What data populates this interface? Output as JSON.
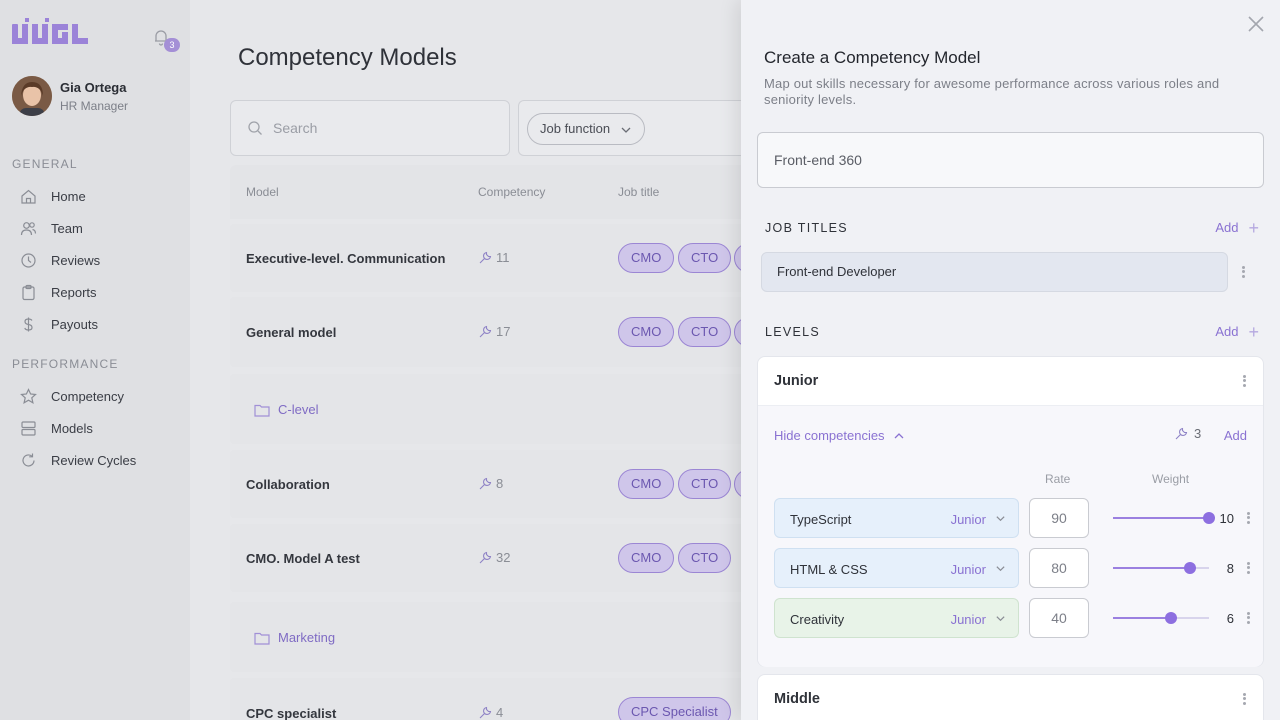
{
  "app": {
    "logo_text": "JUGL",
    "notification_count": "3"
  },
  "user": {
    "name": "Gia Ortega",
    "role": "HR Manager"
  },
  "nav": {
    "general_label": "GENERAL",
    "general_items": [
      {
        "label": "Home",
        "icon": "home-icon"
      },
      {
        "label": "Team",
        "icon": "team-icon"
      },
      {
        "label": "Reviews",
        "icon": "clock-icon"
      },
      {
        "label": "Reports",
        "icon": "clipboard-icon"
      },
      {
        "label": "Payouts",
        "icon": "dollar-icon"
      }
    ],
    "performance_label": "PERFORMANCE",
    "performance_items": [
      {
        "label": "Competency",
        "icon": "star-icon"
      },
      {
        "label": "Models",
        "icon": "models-icon"
      },
      {
        "label": "Review Cycles",
        "icon": "refresh-icon"
      }
    ]
  },
  "main": {
    "title": "Competency Models",
    "search_placeholder": "Search",
    "filter_label": "Job function",
    "columns": [
      "Model",
      "Competency",
      "Job title"
    ],
    "rows": [
      {
        "name": "Executive-level. Communication",
        "count": "11",
        "tags": [
          "CMO",
          "CTO"
        ]
      },
      {
        "name": "General model",
        "count": "17",
        "tags": [
          "CMO",
          "CTO"
        ]
      },
      {
        "folder": "C-level"
      },
      {
        "name": "Collaboration",
        "count": "8",
        "tags": [
          "CMO",
          "CTO"
        ]
      },
      {
        "name": "CMO. Model A test",
        "count": "32",
        "tags": [
          "CMO",
          "CTO"
        ]
      },
      {
        "folder": "Marketing"
      },
      {
        "name": "CPC specialist",
        "count": "4",
        "tags": [
          "CPC Specialist"
        ]
      }
    ]
  },
  "drawer": {
    "title": "Create a Competency Model",
    "subtitle": "Map out skills necessary for awesome performance across various roles and seniority levels.",
    "model_name_value": "Front-end 360",
    "job_titles_label": "JOB TITLES",
    "job_titles_add": "Add",
    "job_titles": [
      "Front-end Developer"
    ],
    "levels_label": "LEVELS",
    "levels_add": "Add",
    "levels": [
      {
        "name": "Junior",
        "hide_label": "Hide competencies",
        "competency_count": "3",
        "add_label": "Add",
        "rate_header": "Rate",
        "weight_header": "Weight",
        "competencies": [
          {
            "skill": "TypeScript",
            "level": "Junior",
            "rate": "90",
            "weight": 10,
            "weight_max": 10,
            "style": "blue"
          },
          {
            "skill": "HTML & CSS",
            "level": "Junior",
            "rate": "80",
            "weight": 8,
            "weight_max": 10,
            "style": "blue"
          },
          {
            "skill": "Creativity",
            "level": "Junior",
            "rate": "40",
            "weight": 6,
            "weight_max": 10,
            "style": "green"
          }
        ]
      },
      {
        "name": "Middle"
      }
    ]
  }
}
